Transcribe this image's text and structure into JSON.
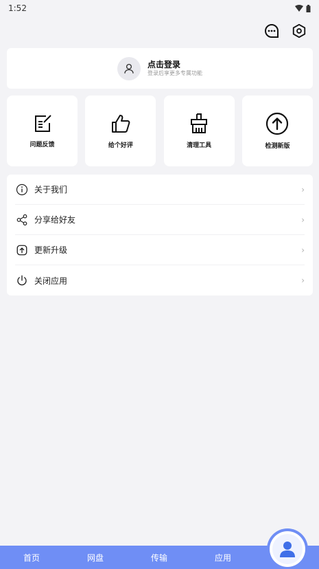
{
  "status_bar": {
    "time": "1:52"
  },
  "profile": {
    "login_title": "点击登录",
    "login_subtitle": "登录后享更多专属功能"
  },
  "tools": [
    {
      "label": "问题反馈",
      "icon": "edit-note-icon"
    },
    {
      "label": "给个好评",
      "icon": "thumbs-up-icon"
    },
    {
      "label": "清理工具",
      "icon": "broom-icon"
    },
    {
      "label": "检测新版",
      "icon": "upgrade-arrow-icon"
    }
  ],
  "menu": [
    {
      "label": "关于我们",
      "icon": "info-icon"
    },
    {
      "label": "分享给好友",
      "icon": "share-icon"
    },
    {
      "label": "更新升级",
      "icon": "update-icon"
    },
    {
      "label": "关闭应用",
      "icon": "power-icon"
    }
  ],
  "bottom_nav": [
    "首页",
    "网盘",
    "传输",
    "应用"
  ],
  "colors": {
    "accent": "#6f8ef5",
    "background": "#f3f3f6"
  }
}
